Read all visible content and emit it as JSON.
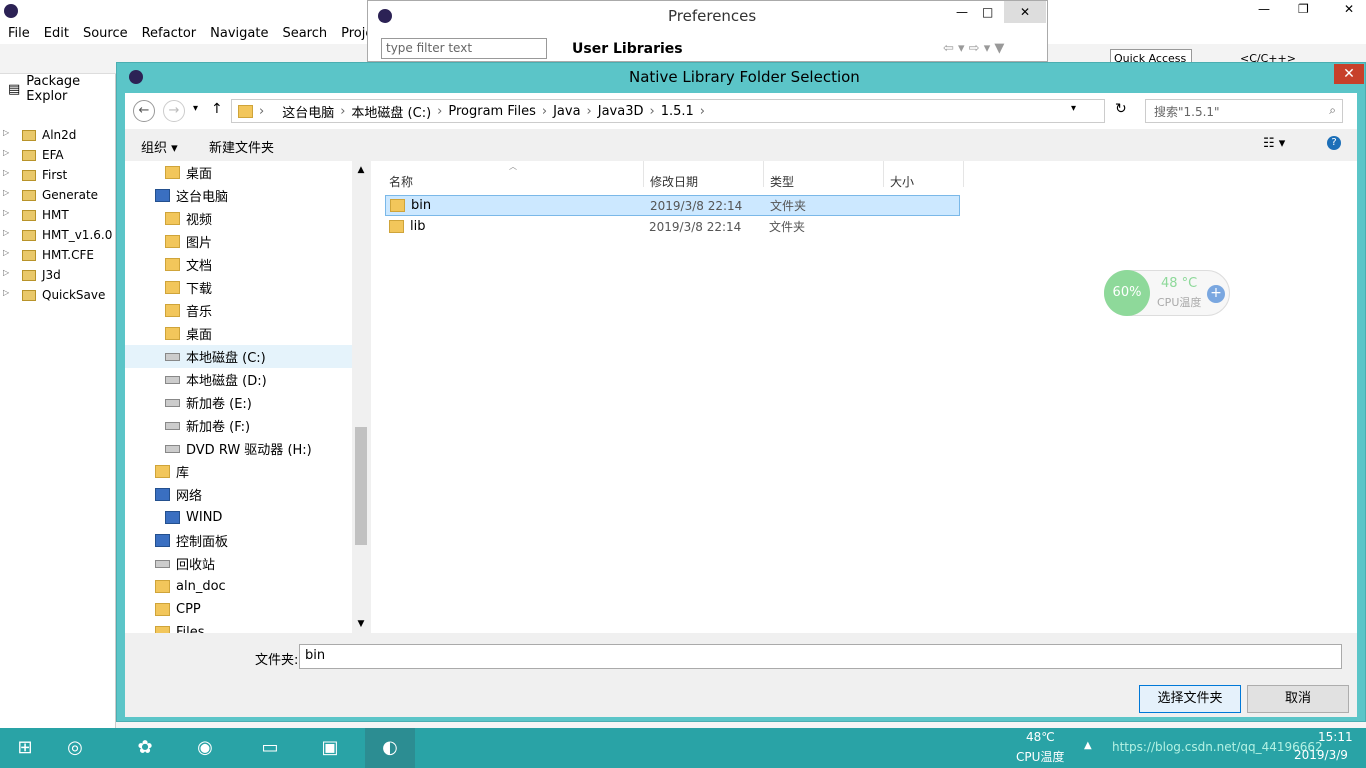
{
  "eclipse": {
    "menu": [
      "File",
      "Edit",
      "Source",
      "Refactor",
      "Navigate",
      "Search",
      "Project"
    ],
    "package_explorer": {
      "title": "Package Explor",
      "projects": [
        "Aln2d",
        "EFA",
        "First",
        "Generate",
        "HMT",
        "HMT_v1.6.0",
        "HMT.CFE",
        "J3d",
        "QuickSave"
      ]
    },
    "quick_access": "Quick Access",
    "perspective": "<C/C++>"
  },
  "preferences": {
    "title": "Preferences",
    "filter_placeholder": "type filter text",
    "page_title": "User Libraries"
  },
  "dialog": {
    "title": "Native Library Folder Selection",
    "breadcrumb": [
      "这台电脑",
      "本地磁盘 (C:)",
      "Program Files",
      "Java",
      "Java3D",
      "1.5.1"
    ],
    "search_placeholder": "搜索\"1.5.1\"",
    "organize": "组织 ▾",
    "new_folder": "新建文件夹",
    "tree": [
      {
        "label": "桌面",
        "icon": "folder",
        "indent": 2
      },
      {
        "label": "这台电脑",
        "icon": "pc",
        "indent": 1
      },
      {
        "label": "视频",
        "icon": "folder",
        "indent": 2
      },
      {
        "label": "图片",
        "icon": "folder",
        "indent": 2
      },
      {
        "label": "文档",
        "icon": "folder",
        "indent": 2
      },
      {
        "label": "下载",
        "icon": "folder",
        "indent": 2
      },
      {
        "label": "音乐",
        "icon": "folder",
        "indent": 2
      },
      {
        "label": "桌面",
        "icon": "folder",
        "indent": 2
      },
      {
        "label": "本地磁盘 (C:)",
        "icon": "drive",
        "indent": 2,
        "selected": true
      },
      {
        "label": "本地磁盘 (D:)",
        "icon": "drive",
        "indent": 2
      },
      {
        "label": "新加卷 (E:)",
        "icon": "drive",
        "indent": 2
      },
      {
        "label": "新加卷 (F:)",
        "icon": "drive",
        "indent": 2
      },
      {
        "label": "DVD RW 驱动器 (H:)",
        "icon": "drive",
        "indent": 2
      },
      {
        "label": "库",
        "icon": "folder",
        "indent": 1
      },
      {
        "label": "网络",
        "icon": "pc",
        "indent": 1
      },
      {
        "label": "WIND",
        "icon": "pc",
        "indent": 2
      },
      {
        "label": "控制面板",
        "icon": "pc",
        "indent": 1
      },
      {
        "label": "回收站",
        "icon": "drive",
        "indent": 1
      },
      {
        "label": "aln_doc",
        "icon": "folder",
        "indent": 1
      },
      {
        "label": "CPP",
        "icon": "folder",
        "indent": 1
      },
      {
        "label": "Files",
        "icon": "folder",
        "indent": 1
      }
    ],
    "columns": {
      "name": "名称",
      "modified": "修改日期",
      "type": "类型",
      "size": "大小"
    },
    "files": [
      {
        "name": "bin",
        "modified": "2019/3/8 22:14",
        "type": "文件夹",
        "selected": true
      },
      {
        "name": "lib",
        "modified": "2019/3/8 22:14",
        "type": "文件夹",
        "selected": false
      }
    ],
    "folder_label": "文件夹:",
    "folder_value": "bin",
    "select_button": "选择文件夹",
    "cancel_button": "取消"
  },
  "cpu_widget": {
    "load": "60%",
    "temp": "48 °C",
    "label": "CPU温度"
  },
  "taskbar": {
    "temp": "48℃",
    "temp_label": "CPU温度",
    "time": "15:11",
    "date": "2019/3/9",
    "watermark": "https://blog.csdn.net/qq_44196662"
  }
}
